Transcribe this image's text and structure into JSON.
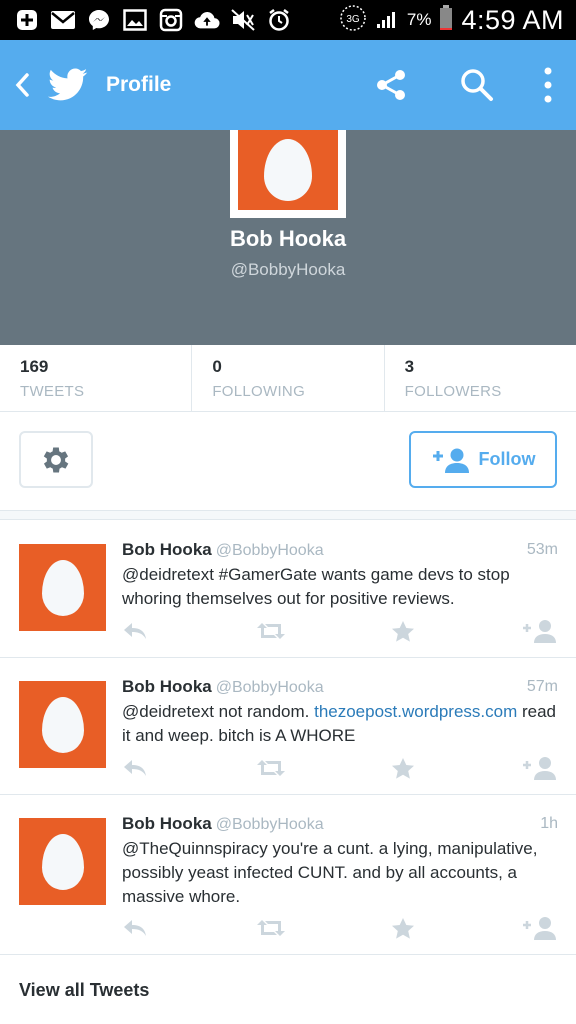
{
  "status_bar": {
    "battery": "7%",
    "time": "4:59 AM",
    "network": "3G"
  },
  "app_bar": {
    "title": "Profile"
  },
  "profile": {
    "name": "Bob Hooka",
    "handle": "@BobbyHooka"
  },
  "stats": [
    {
      "value": "169",
      "label": "TWEETS"
    },
    {
      "value": "0",
      "label": "FOLLOWING"
    },
    {
      "value": "3",
      "label": "FOLLOWERS"
    }
  ],
  "follow_button": {
    "label": "Follow"
  },
  "tweets": [
    {
      "name": "Bob Hooka",
      "handle": "@BobbyHooka",
      "time": "53m",
      "text": "@deidretext #GamerGate wants game devs to stop whoring themselves out for positive reviews."
    },
    {
      "name": "Bob Hooka",
      "handle": "@BobbyHooka",
      "time": "57m",
      "text_before": "@deidretext not random. ",
      "link": "thezoepost.wordpress.com",
      "text_after": " read it and weep. bitch is A WHORE"
    },
    {
      "name": "Bob Hooka",
      "handle": "@BobbyHooka",
      "time": "1h",
      "text": "@TheQuinnspiracy you're a cunt. a lying, manipulative, possibly yeast infected CUNT. and by all accounts, a massive whore."
    }
  ],
  "view_all": "View all Tweets",
  "colors": {
    "brand": "#55acee",
    "banner": "#66757f",
    "avatar": "#e85e26",
    "link": "#2b7bb9"
  }
}
